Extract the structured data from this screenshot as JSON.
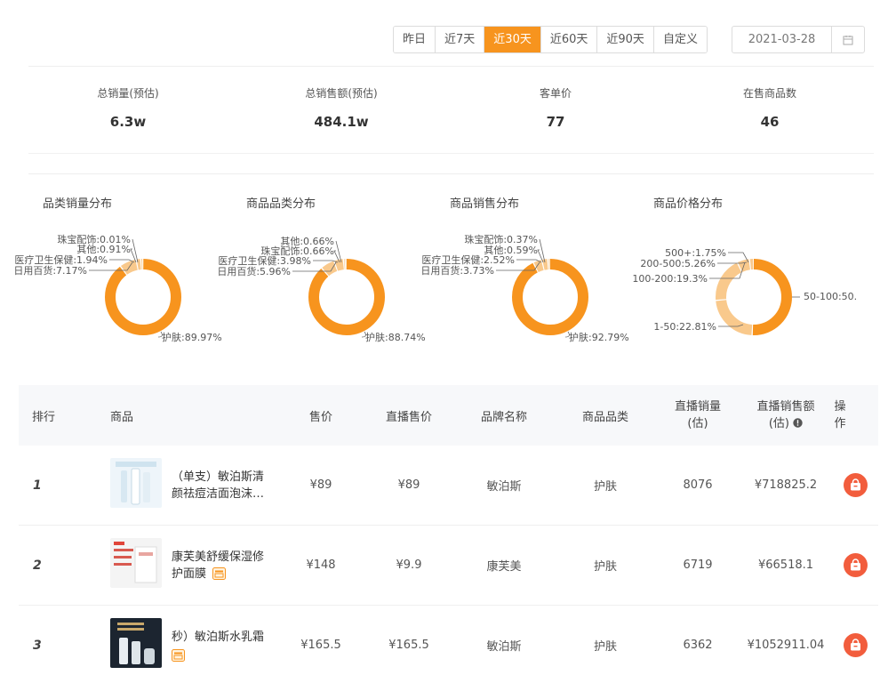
{
  "toolbar": {
    "ranges": [
      "昨日",
      "近7天",
      "近30天",
      "近60天",
      "近90天",
      "自定义"
    ],
    "active_range": "近30天",
    "date": "2021-03-28"
  },
  "stats": [
    {
      "label": "总销量(预估)",
      "value": "6.3w"
    },
    {
      "label": "总销售额(预估)",
      "value": "484.1w"
    },
    {
      "label": "客单价",
      "value": "77"
    },
    {
      "label": "在售商品数",
      "value": "46"
    }
  ],
  "colors": {
    "accent": "#f7941e",
    "donut_light": "#f9c98c",
    "op_button": "#f25d3d"
  },
  "chart_data": [
    {
      "type": "pie",
      "title": "品类销量分布",
      "slices": [
        {
          "name": "护肤",
          "value": 89.97,
          "label": "护肤:89.97%"
        },
        {
          "name": "日用百货",
          "value": 7.17,
          "label": "日用百货:7.17%"
        },
        {
          "name": "医疗卫生保健",
          "value": 1.94,
          "label": "医疗卫生保健:1.94%"
        },
        {
          "name": "其他",
          "value": 0.91,
          "label": "其他:0.91%"
        },
        {
          "name": "珠宝配饰",
          "value": 0.01,
          "label": "珠宝配饰:0.01%"
        }
      ]
    },
    {
      "type": "pie",
      "title": "商品品类分布",
      "slices": [
        {
          "name": "护肤",
          "value": 88.74,
          "label": "护肤:88.74%"
        },
        {
          "name": "日用百货",
          "value": 5.96,
          "label": "日用百货:5.96%"
        },
        {
          "name": "医疗卫生保健",
          "value": 3.98,
          "label": "医疗卫生保健:3.98%"
        },
        {
          "name": "珠宝配饰",
          "value": 0.66,
          "label": "珠宝配饰:0.66%"
        },
        {
          "name": "其他",
          "value": 0.66,
          "label": "其他:0.66%"
        }
      ]
    },
    {
      "type": "pie",
      "title": "商品销售分布",
      "slices": [
        {
          "name": "护肤",
          "value": 92.79,
          "label": "护肤:92.79%"
        },
        {
          "name": "日用百货",
          "value": 3.73,
          "label": "日用百货:3.73%"
        },
        {
          "name": "医疗卫生保健",
          "value": 2.52,
          "label": "医疗卫生保健:2.52%"
        },
        {
          "name": "其他",
          "value": 0.59,
          "label": "其他:0.59%"
        },
        {
          "name": "珠宝配饰",
          "value": 0.37,
          "label": "珠宝配饰:0.37%"
        }
      ]
    },
    {
      "type": "pie",
      "title": "商品价格分布",
      "slices": [
        {
          "name": "50-100",
          "value": 50.89,
          "label": "50-100:50."
        },
        {
          "name": "1-50",
          "value": 22.81,
          "label": "1-50:22.81%"
        },
        {
          "name": "100-200",
          "value": 19.3,
          "label": "100-200:19.3%"
        },
        {
          "name": "200-500",
          "value": 5.26,
          "label": "200-500:5.26%"
        },
        {
          "name": "500+",
          "value": 1.75,
          "label": "500+:1.75%"
        }
      ]
    }
  ],
  "table": {
    "headers": {
      "rank": "排行",
      "product": "商品",
      "price": "售价",
      "live_price": "直播售价",
      "brand": "品牌名称",
      "category": "商品品类",
      "live_sales_1": "直播销量",
      "live_sales_2": "(估)",
      "live_amount_1": "直播销售额",
      "live_amount_2": "(估)",
      "op_1": "操",
      "op_2": "作"
    },
    "rows": [
      {
        "rank": "1",
        "name_1": "（单支）敏泊斯清",
        "name_2": "颜祛痘洁面泡沫…",
        "price": "¥89",
        "live_price": "¥89",
        "brand": "敏泊斯",
        "category": "护肤",
        "sales": "8076",
        "amount": "¥718825.2"
      },
      {
        "rank": "2",
        "name_1": "康芙美舒缓保湿修",
        "name_2": "护面膜",
        "price": "¥148",
        "live_price": "¥9.9",
        "brand": "康芙美",
        "category": "护肤",
        "sales": "6719",
        "amount": "¥66518.1"
      },
      {
        "rank": "3",
        "name_1": "秒）敏泊斯水乳霜",
        "name_2": "",
        "price": "¥165.5",
        "live_price": "¥165.5",
        "brand": "敏泊斯",
        "category": "护肤",
        "sales": "6362",
        "amount": "¥1052911.04"
      }
    ]
  }
}
